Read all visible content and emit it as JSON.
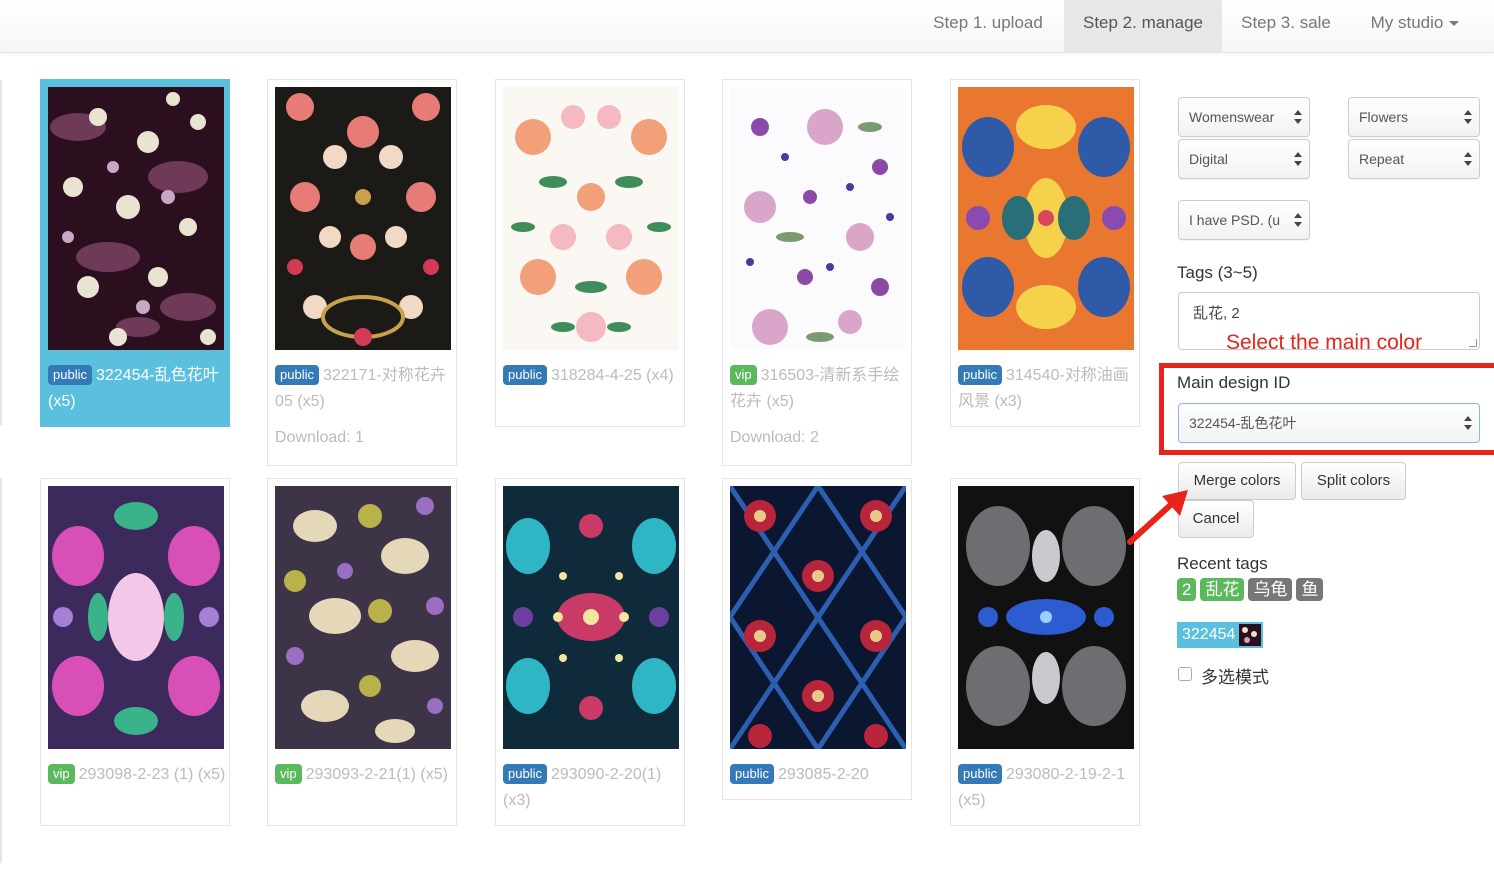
{
  "nav": {
    "upload": "Step 1. upload",
    "manage": "Step 2. manage",
    "sale": "Step 3. sale",
    "studio": "My studio"
  },
  "designs": [
    {
      "badge": "public",
      "title": "322454-乱色花叶 (x5)",
      "download": "",
      "selected": true
    },
    {
      "badge": "public",
      "title": "322171-对称花卉05 (x5)",
      "download": "Download: 1"
    },
    {
      "badge": "public",
      "title": "318284-4-25 (x4)",
      "download": ""
    },
    {
      "badge": "vip",
      "title": "316503-清新系手绘花卉 (x5)",
      "download": "Download: 2"
    },
    {
      "badge": "public",
      "title": "314540-对称油画风景 (x3)",
      "download": ""
    },
    {
      "badge": "vip",
      "title": "293098-2-23 (1) (x5)",
      "download": ""
    },
    {
      "badge": "vip",
      "title": "293093-2-21(1) (x5)",
      "download": ""
    },
    {
      "badge": "public",
      "title": "293090-2-20(1) (x3)",
      "download": ""
    },
    {
      "badge": "public",
      "title": "293085-2-20",
      "download": ""
    },
    {
      "badge": "public",
      "title": "293080-2-19-2-1 (x5)",
      "download": ""
    }
  ],
  "sidebar": {
    "category": "Womenswear",
    "theme": "Flowers",
    "technique": "Digital",
    "layout": "Repeat",
    "psd": "I have PSD. (u",
    "tags_label": "Tags (3~5)",
    "tags_value": "乱花, 2",
    "annotation": "Select the main color",
    "main_id_label": "Main design ID",
    "main_id_value": "322454-乱色花叶",
    "merge": "Merge colors",
    "split": "Split colors",
    "cancel": "Cancel",
    "recent_label": "Recent tags",
    "recent_tags": [
      "2",
      "乱花",
      "乌龟",
      "鱼"
    ],
    "recent_id": "322454",
    "multi_select": "多选模式"
  },
  "colors": {
    "selected": "#5bc0de",
    "public_badge": "#337ab7",
    "vip_badge": "#5cb85c",
    "annotation": "#e8231b"
  }
}
